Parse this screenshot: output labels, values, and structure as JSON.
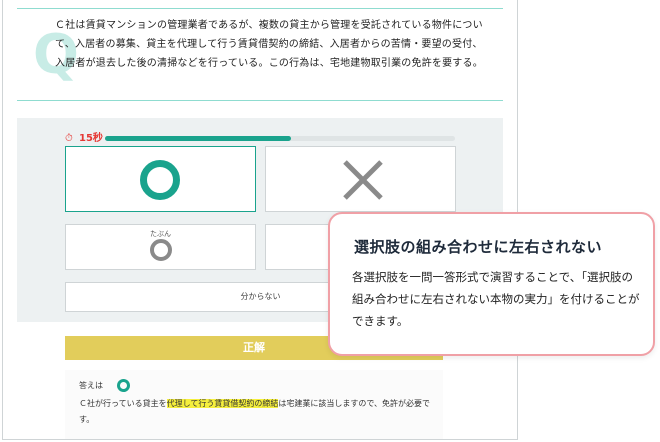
{
  "question": {
    "watermark": "Q",
    "text": "Ｃ社は賃貸マンションの管理業者であるが、複数の貸主から管理を受託されている物件について、入居者の募集、貸主を代理して行う賃貸借契約の締結、入居者からの苦情・要望の受付、入居者が退去した後の清掃などを行っている。この行為は、宅地建物取引業の免許を要する。"
  },
  "timer": {
    "label": "15秒",
    "progress_fraction": 0.53,
    "color": "#e53935"
  },
  "options": {
    "maru": "○",
    "batsu": "×",
    "tabun_label": "たぶん",
    "unknown": "分からない"
  },
  "result": {
    "label": "正解",
    "answer_prefix": "答えは",
    "explanation_before": "Ｃ社が行っている貸主を",
    "explanation_highlight": "代理して行う賃貸借契約の締結",
    "explanation_after": "は宅建業に該当しますので、免許が必要です。"
  },
  "callout": {
    "title": "選択肢の組み合わせに左右されない",
    "body": "各選択肢を一問一答形式で演習することで、「選択肢の組み合わせに左右されない本物の実力」を付けることができます。"
  },
  "colors": {
    "accent": "#1aa38d",
    "result_bar": "#e2cd5b",
    "callout_border": "#f0a0a6",
    "highlight": "#f5ef3d"
  }
}
